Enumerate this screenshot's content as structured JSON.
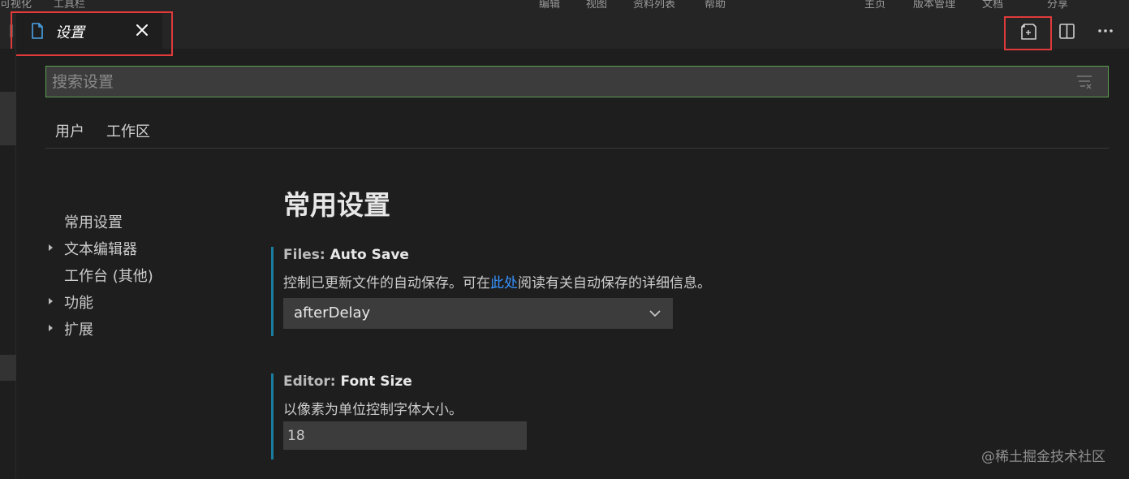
{
  "top_strip": {
    "crumbs": [
      "可视化",
      "工具栏",
      "编辑",
      "视图",
      "资料列表",
      "帮助",
      "主页",
      "版本管理",
      "文档",
      "分享"
    ]
  },
  "tab": {
    "title": "设置",
    "close_glyph": "×"
  },
  "colors": {
    "highlight": "#e03a3a",
    "accent_bar": "#1b7ca0",
    "link": "#3794ff",
    "search_border": "#5e9e52"
  },
  "search": {
    "placeholder": "搜索设置",
    "value": ""
  },
  "scope_tabs": [
    "用户",
    "工作区"
  ],
  "toc": [
    {
      "label": "常用设置",
      "expandable": false
    },
    {
      "label": "文本编辑器",
      "expandable": true
    },
    {
      "label": "工作台 (其他)",
      "expandable": false
    },
    {
      "label": "功能",
      "expandable": true
    },
    {
      "label": "扩展",
      "expandable": true
    }
  ],
  "section_title": "常用设置",
  "settings": [
    {
      "category": "Files: ",
      "name": "Auto Save",
      "desc_before": "控制已更新文件的自动保存。可在",
      "desc_link": "此处",
      "desc_after": "阅读有关自动保存的详细信息。",
      "value": "afterDelay"
    },
    {
      "category": "Editor: ",
      "name": "Font Size",
      "desc": "以像素为单位控制字体大小。",
      "value": "18"
    }
  ],
  "icons": {
    "tab_file": "file-icon",
    "tab_close": "close-icon",
    "open_json": "open-settings-json-icon",
    "split": "split-editor-icon",
    "more": "more-actions-icon",
    "clear": "clear-filter-icon",
    "dropdown": "chevron-down-icon"
  },
  "watermark": "@稀土掘金技术社区"
}
